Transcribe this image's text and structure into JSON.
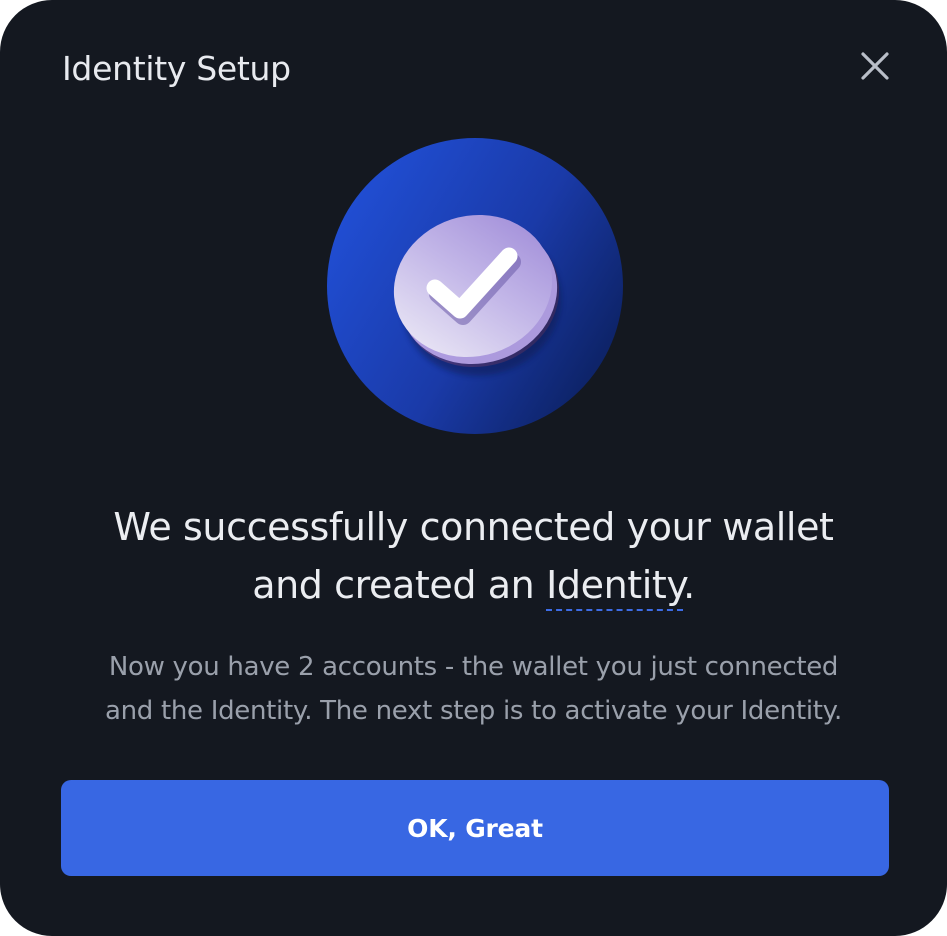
{
  "dialog": {
    "title": "Identity Setup",
    "close_icon": "close-icon"
  },
  "hero": {
    "icon": "checkmark-coin-icon",
    "colors": {
      "circle_dark": "#0d2466",
      "circle_light": "#1f4fd6",
      "coin_light": "#d8d2ee",
      "coin_dark": "#9a86d4",
      "check": "#ffffff"
    }
  },
  "message": {
    "headline_line1": "We successfully connected your wallet",
    "headline_line2_prefix": "and created an ",
    "headline_term": "Identity",
    "headline_suffix": ".",
    "body_line1": "Now you have 2 accounts - the wallet you just connected",
    "body_line2": "and the Identity. The next step is to activate your Identity."
  },
  "actions": {
    "primary_label": "OK, Great"
  },
  "theme": {
    "background": "#141820",
    "accent": "#3867e3",
    "text_primary": "#ebedf1",
    "text_secondary": "#9aa0ab"
  }
}
